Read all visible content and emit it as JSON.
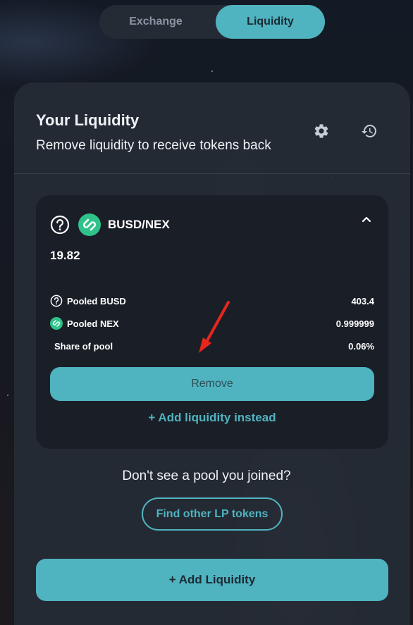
{
  "tabs": {
    "exchange": "Exchange",
    "liquidity": "Liquidity",
    "active": "Liquidity"
  },
  "header": {
    "title": "Your Liquidity",
    "subtitle": "Remove liquidity to receive tokens back",
    "settings_icon": "gear-icon",
    "history_icon": "history-icon"
  },
  "pool": {
    "pair": "BUSD/NEX",
    "balance": "19.82",
    "rows": [
      {
        "label": "Pooled BUSD",
        "value": "403.4",
        "icon": "question-circle-icon"
      },
      {
        "label": "Pooled NEX",
        "value": "0.999999",
        "icon": "nex-token-icon"
      },
      {
        "label": "Share of pool",
        "value": "0.06%"
      }
    ],
    "remove_label": "Remove",
    "add_instead_label": "+ Add liquidity instead"
  },
  "footer": {
    "prompt": "Don't see a pool you joined?",
    "find_label": "Find other LP tokens",
    "add_liquidity_label": "+ Add Liquidity"
  },
  "colors": {
    "accent": "#4fb4c0",
    "card": "#252b35",
    "pool_bg": "#1a1e27",
    "nex_green": "#2fc28a",
    "annotation_arrow": "#e8261c"
  }
}
